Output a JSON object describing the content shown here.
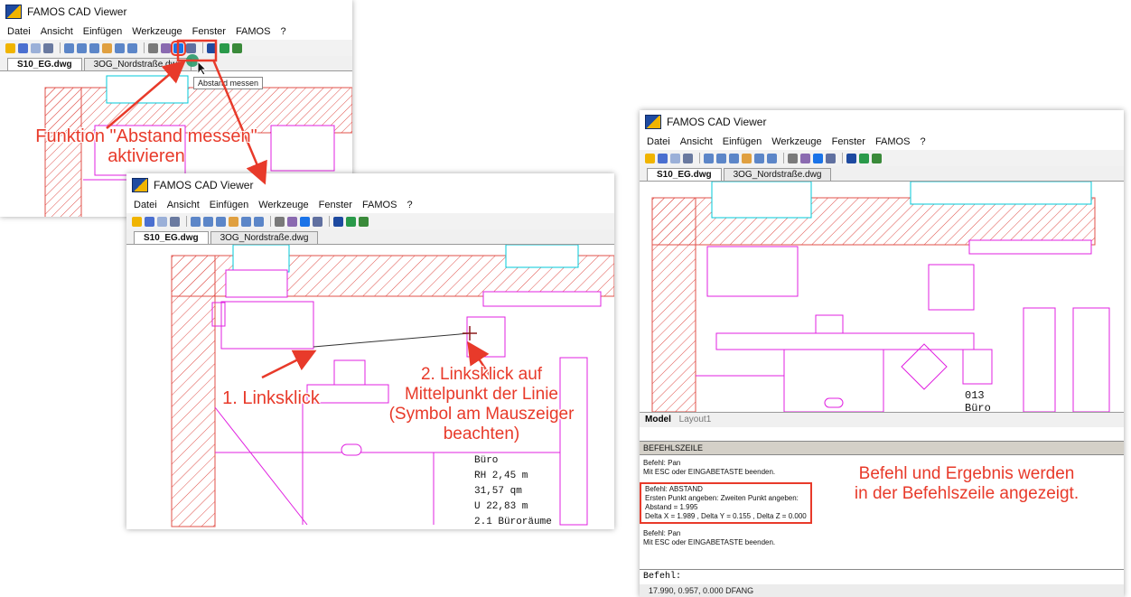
{
  "app": {
    "title": "FAMOS CAD Viewer",
    "menu": [
      "Datei",
      "Ansicht",
      "Einfügen",
      "Werkzeuge",
      "Fenster",
      "FAMOS",
      "?"
    ],
    "tabs": [
      "S10_EG.dwg",
      "3OG_Nordstraße.dwg"
    ],
    "layout_tabs": [
      "Model",
      "Layout1"
    ]
  },
  "tooltip": "Abstand messen",
  "annotations": {
    "activate": "Funktion \"Abstand messen\" aktivieren",
    "first_click": "1. Linksklick",
    "second_click": "2. Linksklick auf Mittelpunkt der Linie (Symbol am Mauszeiger beachten)",
    "result": "Befehl und Ergebnis werden in der Befehlszeile angezeigt."
  },
  "room_labels": {
    "screen2": [
      "Büro",
      "RH 2,45 m",
      "31,57 qm",
      "U 22,83 m",
      "2.1 Büroräume"
    ],
    "screen3": [
      "013",
      "Büro"
    ]
  },
  "command_panel": {
    "header": "BEFEHLSZEILE",
    "block1": [
      "Befehl: Pan",
      "Mit ESC oder EINGABETASTE beenden."
    ],
    "block2": [
      "Befehl: ABSTAND",
      "Ersten Punkt angeben:  Zweiten Punkt angeben:",
      "Abstand = 1.995",
      "Delta X = 1.989 ,  Delta Y = 0.155 ,  Delta Z = 0.000"
    ],
    "block3": [
      "Befehl: Pan",
      "Mit ESC oder EINGABETASTE beenden."
    ],
    "input_label": "Befehl:",
    "status": "17.990, 0.957, 0.000   DFANG"
  },
  "colors": {
    "accent": "#e83a2a",
    "wall_hatch": "#e0504a",
    "cad_magenta": "#e020e0",
    "cad_cyan": "#00c8d8",
    "highlight": "#1a73e8"
  },
  "icons": [
    "open-icon",
    "save-icon",
    "print-preview-icon",
    "print-icon",
    "zoom-window-icon",
    "zoom-in-icon",
    "zoom-out-icon",
    "pan-icon",
    "zoom-extents-icon",
    "zoom-previous-icon",
    "layers-icon",
    "properties-icon",
    "measure-distance-icon",
    "hatch-icon",
    "famos-icon",
    "export-icon",
    "link-icon"
  ]
}
